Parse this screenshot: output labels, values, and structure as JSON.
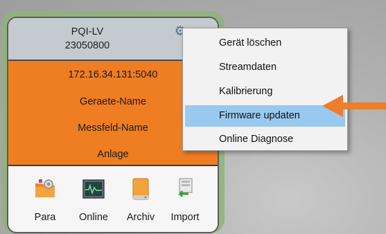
{
  "device_card": {
    "name": "PQI-LV",
    "serial": "23050800",
    "ip_port": "172.16.34.131:5040",
    "device_name_label": "Geraete-Name",
    "measurement_field_label": "Messfeld-Name",
    "plant_label": "Anlage"
  },
  "toolbar": {
    "items": [
      {
        "label": "Para",
        "icon": "folder-settings-icon"
      },
      {
        "label": "Online",
        "icon": "monitor-waveform-icon"
      },
      {
        "label": "Archiv",
        "icon": "archive-drive-icon"
      },
      {
        "label": "Import",
        "icon": "import-icon"
      }
    ]
  },
  "context_menu": {
    "items": [
      {
        "label": "Gerät löschen",
        "highlighted": false
      },
      {
        "label": "Streamdaten",
        "highlighted": false
      },
      {
        "label": "Kalibrierung",
        "highlighted": false
      },
      {
        "label": "Firmware updaten",
        "highlighted": true
      },
      {
        "label": "Online Diagnose",
        "highlighted": false
      }
    ]
  },
  "colors": {
    "card_info_bg": "#ef7d22",
    "header_bg": "#c4cbd0",
    "card_glow": "#8fb37a",
    "menu_highlight": "#99c9ef",
    "arrow": "#ee7d2c"
  }
}
